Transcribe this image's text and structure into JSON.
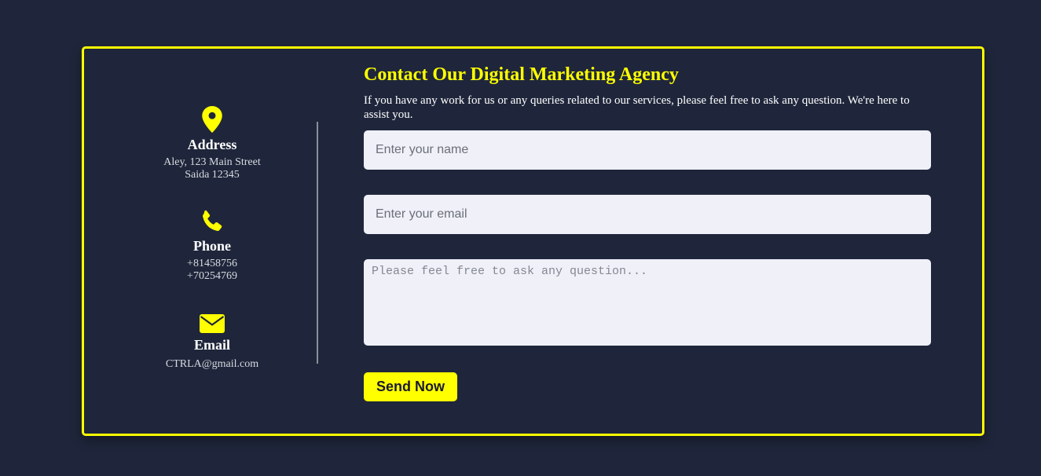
{
  "colors": {
    "background": "#1f263b",
    "accent": "#ffff00",
    "field_background": "#eff0f8",
    "divider": "#8a8f99"
  },
  "contact_info": {
    "address": {
      "icon": "map-pin-icon",
      "title": "Address",
      "lines": [
        "Aley, 123 Main Street",
        "Saida 12345"
      ]
    },
    "phone": {
      "icon": "phone-icon",
      "title": "Phone",
      "lines": [
        "+81458756",
        "+70254769"
      ]
    },
    "email": {
      "icon": "envelope-icon",
      "title": "Email",
      "lines": [
        "CTRLA@gmail.com"
      ]
    }
  },
  "form": {
    "heading": "Contact Our Digital Marketing Agency",
    "description": "If you have any work for us or any queries related to our services, please feel free to ask any question. We're here to assist you.",
    "name_placeholder": "Enter your name",
    "email_placeholder": "Enter your email",
    "message_placeholder": "Please feel free to ask any question...",
    "submit_label": "Send Now"
  }
}
